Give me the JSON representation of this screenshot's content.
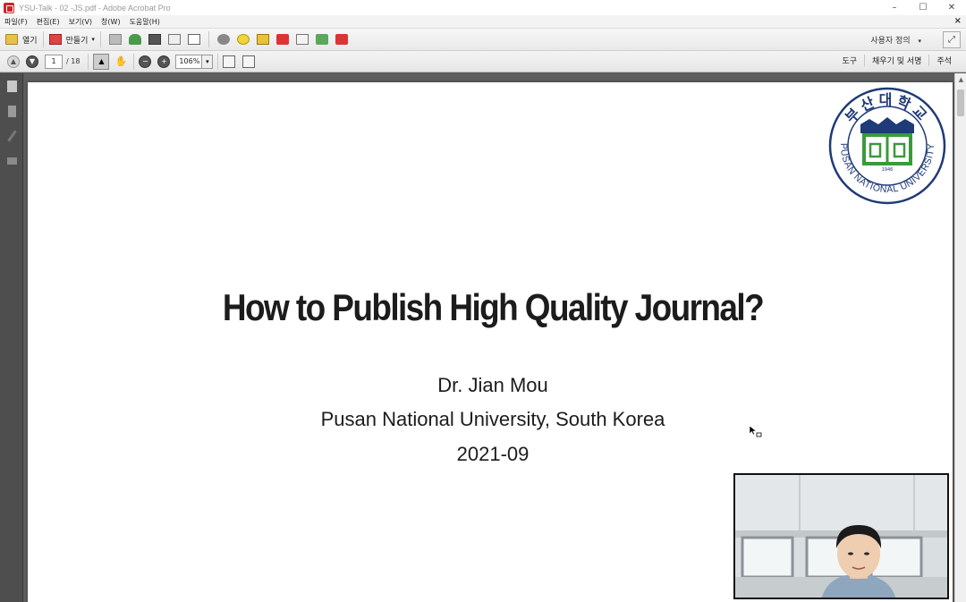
{
  "window": {
    "title": "YSU-Talk - 02 -JS.pdf - Adobe Acrobat Pro",
    "min_glyph": "–",
    "max_glyph": "☐",
    "close_glyph": "✕"
  },
  "menu": {
    "items": [
      "파일(F)",
      "편집(E)",
      "보기(V)",
      "창(W)",
      "도움말(H)"
    ],
    "close_doc": "×"
  },
  "toolbar": {
    "open_label": "열기",
    "create_label": "만들기",
    "create_arrow": "▾",
    "customize_label": "사용자 정의",
    "customize_arrow": "▾"
  },
  "navbar": {
    "current_page": "1",
    "total_pages": "/ 18",
    "zoom": "106%",
    "zoom_arrow": "▾",
    "tabs": [
      "도구",
      "채우기 및 서명",
      "주석"
    ]
  },
  "slide": {
    "title": "How to Publish High Quality Journal?",
    "author": "Dr. Jian Mou",
    "affiliation": "Pusan National University, South Korea",
    "date": "2021-09"
  },
  "logo": {
    "korean_text": "부산대학교",
    "english_text": "PUSAN NATIONAL UNIVERSITY",
    "year": "1946"
  },
  "icons": {
    "up": "▲",
    "down": "▼",
    "zoom_out": "−",
    "zoom_in": "+",
    "hand": "✋",
    "select": "▲",
    "scroll_up": "▲"
  },
  "colors": {
    "logo_blue": "#1f3a78",
    "logo_green": "#3a9a3a",
    "page_bg": "#ffffff",
    "workspace_bg": "#5e5e5e"
  }
}
